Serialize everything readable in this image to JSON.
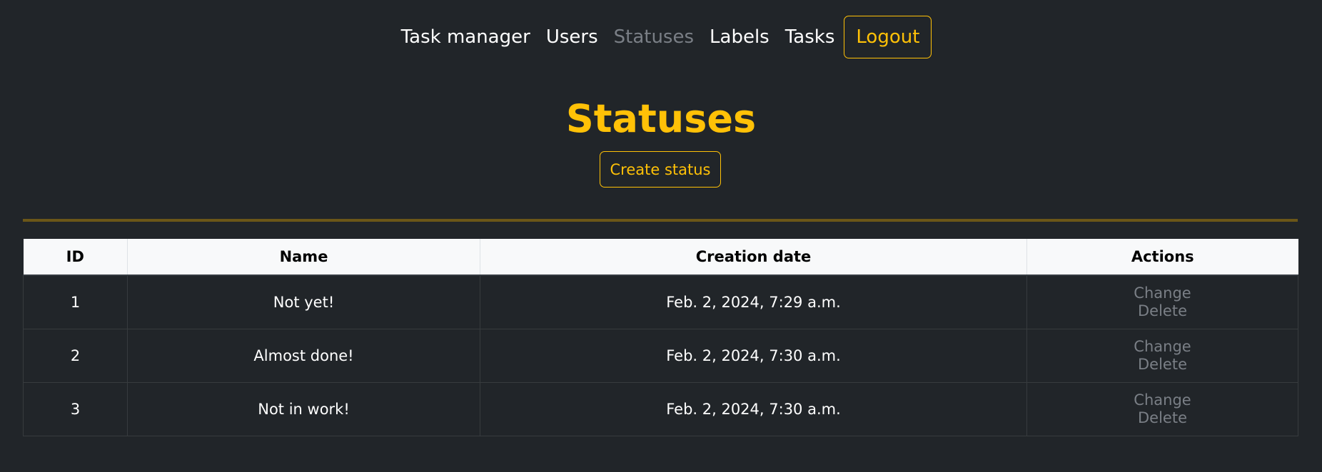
{
  "nav": {
    "brand": "Task manager",
    "users": "Users",
    "statuses": "Statuses",
    "labels": "Labels",
    "tasks": "Tasks",
    "logout": "Logout"
  },
  "page": {
    "title": "Statuses",
    "create_button": "Create status"
  },
  "table": {
    "headers": [
      "ID",
      "Name",
      "Creation date",
      "Actions"
    ],
    "rows": [
      {
        "id": "1",
        "name": "Not yet!",
        "created": "Feb. 2, 2024, 7:29 a.m.",
        "change": "Change",
        "delete": "Delete"
      },
      {
        "id": "2",
        "name": "Almost done!",
        "created": "Feb. 2, 2024, 7:30 a.m.",
        "change": "Change",
        "delete": "Delete"
      },
      {
        "id": "3",
        "name": "Not in work!",
        "created": "Feb. 2, 2024, 7:30 a.m.",
        "change": "Change",
        "delete": "Delete"
      }
    ]
  },
  "colors": {
    "background": "#212529",
    "accent": "#ffc107",
    "muted": "#7a7f86",
    "header_bg": "#f8f9fa"
  }
}
